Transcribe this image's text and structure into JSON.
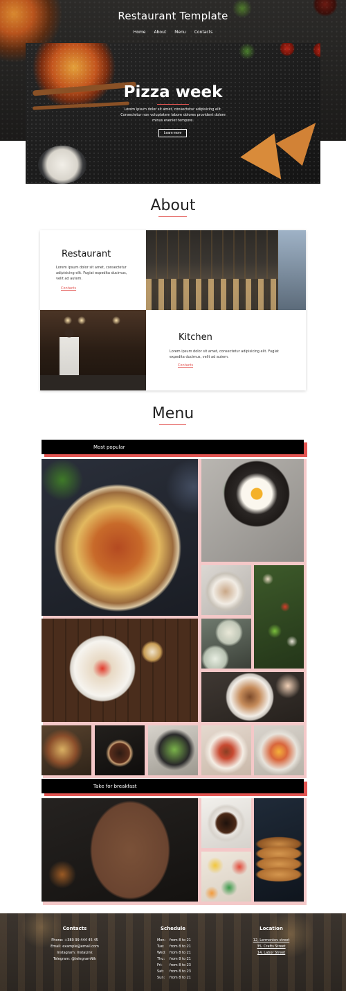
{
  "site": {
    "title": "Restaurant Template"
  },
  "nav": {
    "items": [
      "Home",
      "About",
      "Menu",
      "Contacts"
    ]
  },
  "hero": {
    "title": "Pizza week",
    "text": "Lorem ipsum dolor sit amet, consectetur adipisicing elit. Consectetur non voluptatem labore dolores provident dolore minus eveniet tempore.",
    "button": "Learn more"
  },
  "about": {
    "title": "About",
    "restaurant": {
      "heading": "Restaurant",
      "text": "Lorem ipsum dolor sit amet, consectetur adipisicing elit. Fugiat expedita ducimus, velit ad autem.",
      "link": "Contacts"
    },
    "kitchen": {
      "heading": "Kitchen",
      "text": "Lorem ipsum dolor sit amet, consectetur adipisicing elit. Fugiat expedita ducimus, velit ad autem.",
      "link": "Contacts"
    }
  },
  "menu": {
    "title": "Menu",
    "categories": [
      "Most popular",
      "Take for breakfast"
    ]
  },
  "footer": {
    "contacts": {
      "title": "Contacts",
      "lines": [
        "Phone: +380 99 444 45 45",
        "Email: example@email.com",
        "Instagram: InstaLink",
        "Telegram: @telegramNik"
      ]
    },
    "schedule": {
      "title": "Schedule",
      "rows": [
        {
          "day": "Mon:",
          "time": "from 8 to 21"
        },
        {
          "day": "Tue:",
          "time": "from 8 to 21"
        },
        {
          "day": "Wed:",
          "time": "from 8 to 21"
        },
        {
          "day": "Thu:",
          "time": "from 8 to 21"
        },
        {
          "day": "Fri:",
          "time": "from 8 to 23"
        },
        {
          "day": "Sat:",
          "time": "from 8 to 23"
        },
        {
          "day": "Sun:",
          "time": "from 8 to 21"
        }
      ]
    },
    "location": {
      "title": "Location",
      "lines": [
        "12, Lermontov street",
        "35, Crafts Street",
        "14, Labor Street"
      ]
    }
  },
  "colors": {
    "accent": "#e25552",
    "accent_light": "#f4c8c8",
    "dark": "#000000"
  }
}
